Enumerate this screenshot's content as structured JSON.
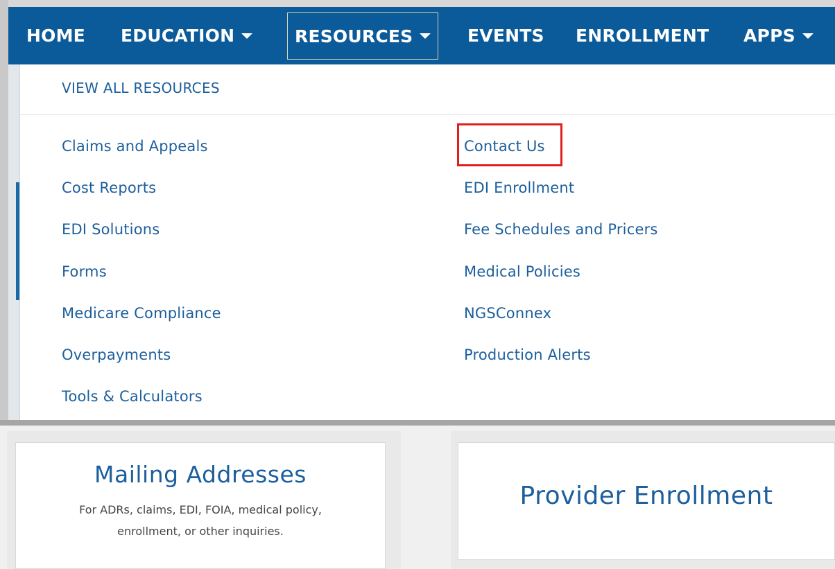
{
  "nav": {
    "items": [
      {
        "label": "HOME",
        "has_dropdown": false
      },
      {
        "label": "EDUCATION",
        "has_dropdown": true
      },
      {
        "label": "RESOURCES",
        "has_dropdown": true,
        "active": true
      },
      {
        "label": "EVENTS",
        "has_dropdown": false
      },
      {
        "label": "ENROLLMENT",
        "has_dropdown": false
      },
      {
        "label": "APPS",
        "has_dropdown": true
      }
    ]
  },
  "dropdown": {
    "view_all": "VIEW ALL RESOURCES",
    "left_column": [
      "Claims and Appeals",
      "Cost Reports",
      "EDI Solutions",
      "Forms",
      "Medicare Compliance",
      "Overpayments",
      "Tools & Calculators"
    ],
    "right_column": [
      "Contact Us",
      "EDI Enrollment",
      "Fee Schedules and Pricers",
      "Medical Policies",
      "NGSConnex",
      "Production Alerts"
    ],
    "highlighted_item": "Contact Us"
  },
  "cards": {
    "mailing": {
      "title": "Mailing Addresses",
      "desc_line1": "For ADRs, claims, EDI, FOIA, medical policy,",
      "desc_line2": "enrollment, or other inquiries."
    },
    "provider": {
      "title": "Provider Enrollment"
    }
  },
  "colors": {
    "nav_bg": "#0b5a99",
    "link": "#1c5f9c",
    "highlight": "#e01e1e"
  }
}
